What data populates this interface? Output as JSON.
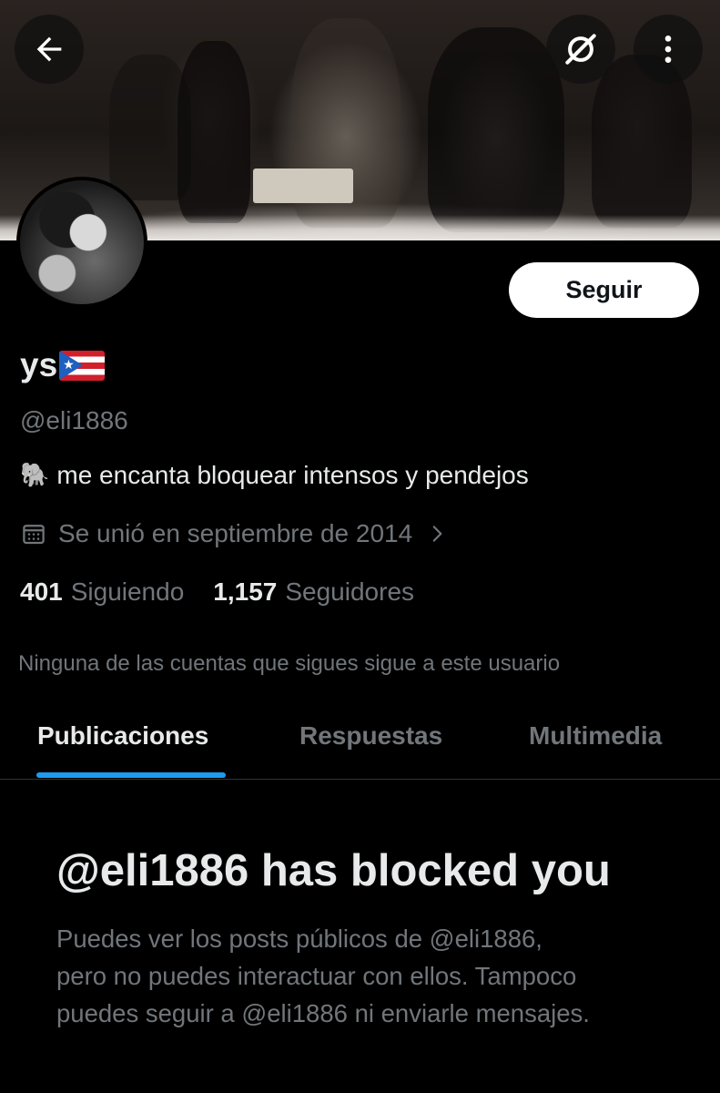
{
  "header": {
    "back_icon": "arrow-left-icon",
    "grok_icon": "circle-slash-icon",
    "more_icon": "more-vertical-icon"
  },
  "profile": {
    "display_name": "ys",
    "flag_icon": "puerto-rico-flag-icon",
    "handle": "@eli1886",
    "bio_icon": "elephant-emoji-icon",
    "bio": "me encanta bloquear intensos y pendejos",
    "joined": "Se unió en septiembre de 2014",
    "following_count": "401",
    "following_label": "Siguiendo",
    "followers_count": "1,157",
    "followers_label": "Seguidores",
    "mutual_note": "Ninguna de las cuentas que sigues sigue a este usuario"
  },
  "actions": {
    "follow_label": "Seguir"
  },
  "tabs": [
    {
      "label": "Publicaciones",
      "active": true
    },
    {
      "label": "Respuestas",
      "active": false
    },
    {
      "label": "Multimedia",
      "active": false
    }
  ],
  "blocked": {
    "title": "@eli1886 has blocked you",
    "line1": "Puedes ver los posts públicos de @eli1886,",
    "line2": "pero no puedes interactuar con ellos. Tampoco",
    "line3": "puedes seguir a @eli1886 ni enviarle mensajes."
  },
  "colors": {
    "background": "#000000",
    "primary_text": "#e7e9ea",
    "secondary_text": "#71767b",
    "accent": "#1d9bf0"
  }
}
